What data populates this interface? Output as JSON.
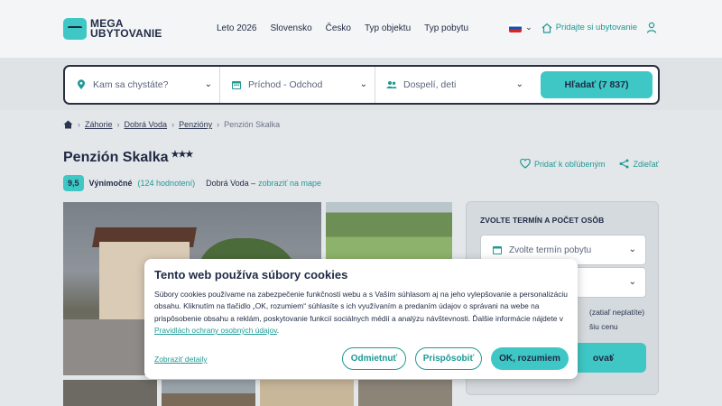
{
  "header": {
    "logo_line1": "MEGA",
    "logo_line2": "UBYTOVANIE",
    "nav": [
      "Leto 2026",
      "Slovensko",
      "Česko",
      "Typ objektu",
      "Typ pobytu"
    ],
    "add_listing": "Pridajte si ubytovanie"
  },
  "search": {
    "destination_placeholder": "Kam sa chystáte?",
    "dates_placeholder": "Príchod - Odchod",
    "guests_placeholder": "Dospelí, deti",
    "button_label": "Hľadať (7 837)"
  },
  "breadcrumb": [
    "Záhorie",
    "Dobrá Voda",
    "Penzióny",
    "Penzión Skalka"
  ],
  "property": {
    "name": "Penzión Skalka",
    "stars": "★★★",
    "score": "9,5",
    "score_label": "Výnimočné",
    "reviews": "(124 hodnotení)",
    "location": "Dobrá Voda –",
    "map_link": "zobraziť na mape",
    "favorite": "Pridať k obľúbeným",
    "share": "Zdieľať"
  },
  "booking": {
    "heading": "ZVOLTE TERMÍN A POČET OSÔB",
    "date_placeholder": "Zvolte termín pobytu",
    "note1": "(zatiaľ neplatíte)",
    "note2": "šiu cenu",
    "button_label": "ovať"
  },
  "cookie": {
    "title": "Tento web používa súbory cookies",
    "body": "Súbory cookies používame na zabezpečenie funkčnosti webu a s Vaším súhlasom aj na jeho vylepšovanie a personalizáciu obsahu. Kliknutím na tlačidlo „OK, rozumiem“ súhlasíte s ich využívaním a predaním údajov o správani na webe na prispôsobenie obsahu a reklám, poskytovanie funkcií sociálnych médií a analýzu návštevnosti. Ďalšie informácie nájdete v",
    "policy_link": "Pravidlách ochrany osobných údajov",
    "body_end": ".",
    "details": "Zobraziť detaily",
    "reject": "Odmietnuť",
    "customize": "Prispôsobiť",
    "accept": "OK, rozumiem"
  },
  "colors": {
    "accent": "#3ec7c4",
    "accent_dark": "#1e9994",
    "text": "#1f2a44"
  }
}
